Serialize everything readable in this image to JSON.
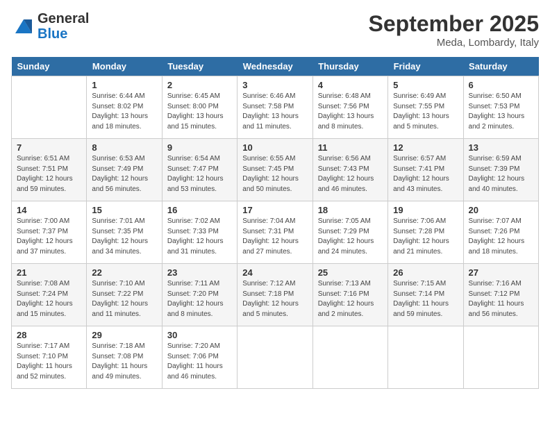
{
  "header": {
    "logo_line1": "General",
    "logo_line2": "Blue",
    "month": "September 2025",
    "location": "Meda, Lombardy, Italy"
  },
  "days_of_week": [
    "Sunday",
    "Monday",
    "Tuesday",
    "Wednesday",
    "Thursday",
    "Friday",
    "Saturday"
  ],
  "weeks": [
    [
      {
        "day": "",
        "sunrise": "",
        "sunset": "",
        "daylight": ""
      },
      {
        "day": "1",
        "sunrise": "Sunrise: 6:44 AM",
        "sunset": "Sunset: 8:02 PM",
        "daylight": "Daylight: 13 hours and 18 minutes."
      },
      {
        "day": "2",
        "sunrise": "Sunrise: 6:45 AM",
        "sunset": "Sunset: 8:00 PM",
        "daylight": "Daylight: 13 hours and 15 minutes."
      },
      {
        "day": "3",
        "sunrise": "Sunrise: 6:46 AM",
        "sunset": "Sunset: 7:58 PM",
        "daylight": "Daylight: 13 hours and 11 minutes."
      },
      {
        "day": "4",
        "sunrise": "Sunrise: 6:48 AM",
        "sunset": "Sunset: 7:56 PM",
        "daylight": "Daylight: 13 hours and 8 minutes."
      },
      {
        "day": "5",
        "sunrise": "Sunrise: 6:49 AM",
        "sunset": "Sunset: 7:55 PM",
        "daylight": "Daylight: 13 hours and 5 minutes."
      },
      {
        "day": "6",
        "sunrise": "Sunrise: 6:50 AM",
        "sunset": "Sunset: 7:53 PM",
        "daylight": "Daylight: 13 hours and 2 minutes."
      }
    ],
    [
      {
        "day": "7",
        "sunrise": "Sunrise: 6:51 AM",
        "sunset": "Sunset: 7:51 PM",
        "daylight": "Daylight: 12 hours and 59 minutes."
      },
      {
        "day": "8",
        "sunrise": "Sunrise: 6:53 AM",
        "sunset": "Sunset: 7:49 PM",
        "daylight": "Daylight: 12 hours and 56 minutes."
      },
      {
        "day": "9",
        "sunrise": "Sunrise: 6:54 AM",
        "sunset": "Sunset: 7:47 PM",
        "daylight": "Daylight: 12 hours and 53 minutes."
      },
      {
        "day": "10",
        "sunrise": "Sunrise: 6:55 AM",
        "sunset": "Sunset: 7:45 PM",
        "daylight": "Daylight: 12 hours and 50 minutes."
      },
      {
        "day": "11",
        "sunrise": "Sunrise: 6:56 AM",
        "sunset": "Sunset: 7:43 PM",
        "daylight": "Daylight: 12 hours and 46 minutes."
      },
      {
        "day": "12",
        "sunrise": "Sunrise: 6:57 AM",
        "sunset": "Sunset: 7:41 PM",
        "daylight": "Daylight: 12 hours and 43 minutes."
      },
      {
        "day": "13",
        "sunrise": "Sunrise: 6:59 AM",
        "sunset": "Sunset: 7:39 PM",
        "daylight": "Daylight: 12 hours and 40 minutes."
      }
    ],
    [
      {
        "day": "14",
        "sunrise": "Sunrise: 7:00 AM",
        "sunset": "Sunset: 7:37 PM",
        "daylight": "Daylight: 12 hours and 37 minutes."
      },
      {
        "day": "15",
        "sunrise": "Sunrise: 7:01 AM",
        "sunset": "Sunset: 7:35 PM",
        "daylight": "Daylight: 12 hours and 34 minutes."
      },
      {
        "day": "16",
        "sunrise": "Sunrise: 7:02 AM",
        "sunset": "Sunset: 7:33 PM",
        "daylight": "Daylight: 12 hours and 31 minutes."
      },
      {
        "day": "17",
        "sunrise": "Sunrise: 7:04 AM",
        "sunset": "Sunset: 7:31 PM",
        "daylight": "Daylight: 12 hours and 27 minutes."
      },
      {
        "day": "18",
        "sunrise": "Sunrise: 7:05 AM",
        "sunset": "Sunset: 7:29 PM",
        "daylight": "Daylight: 12 hours and 24 minutes."
      },
      {
        "day": "19",
        "sunrise": "Sunrise: 7:06 AM",
        "sunset": "Sunset: 7:28 PM",
        "daylight": "Daylight: 12 hours and 21 minutes."
      },
      {
        "day": "20",
        "sunrise": "Sunrise: 7:07 AM",
        "sunset": "Sunset: 7:26 PM",
        "daylight": "Daylight: 12 hours and 18 minutes."
      }
    ],
    [
      {
        "day": "21",
        "sunrise": "Sunrise: 7:08 AM",
        "sunset": "Sunset: 7:24 PM",
        "daylight": "Daylight: 12 hours and 15 minutes."
      },
      {
        "day": "22",
        "sunrise": "Sunrise: 7:10 AM",
        "sunset": "Sunset: 7:22 PM",
        "daylight": "Daylight: 12 hours and 11 minutes."
      },
      {
        "day": "23",
        "sunrise": "Sunrise: 7:11 AM",
        "sunset": "Sunset: 7:20 PM",
        "daylight": "Daylight: 12 hours and 8 minutes."
      },
      {
        "day": "24",
        "sunrise": "Sunrise: 7:12 AM",
        "sunset": "Sunset: 7:18 PM",
        "daylight": "Daylight: 12 hours and 5 minutes."
      },
      {
        "day": "25",
        "sunrise": "Sunrise: 7:13 AM",
        "sunset": "Sunset: 7:16 PM",
        "daylight": "Daylight: 12 hours and 2 minutes."
      },
      {
        "day": "26",
        "sunrise": "Sunrise: 7:15 AM",
        "sunset": "Sunset: 7:14 PM",
        "daylight": "Daylight: 11 hours and 59 minutes."
      },
      {
        "day": "27",
        "sunrise": "Sunrise: 7:16 AM",
        "sunset": "Sunset: 7:12 PM",
        "daylight": "Daylight: 11 hours and 56 minutes."
      }
    ],
    [
      {
        "day": "28",
        "sunrise": "Sunrise: 7:17 AM",
        "sunset": "Sunset: 7:10 PM",
        "daylight": "Daylight: 11 hours and 52 minutes."
      },
      {
        "day": "29",
        "sunrise": "Sunrise: 7:18 AM",
        "sunset": "Sunset: 7:08 PM",
        "daylight": "Daylight: 11 hours and 49 minutes."
      },
      {
        "day": "30",
        "sunrise": "Sunrise: 7:20 AM",
        "sunset": "Sunset: 7:06 PM",
        "daylight": "Daylight: 11 hours and 46 minutes."
      },
      {
        "day": "",
        "sunrise": "",
        "sunset": "",
        "daylight": ""
      },
      {
        "day": "",
        "sunrise": "",
        "sunset": "",
        "daylight": ""
      },
      {
        "day": "",
        "sunrise": "",
        "sunset": "",
        "daylight": ""
      },
      {
        "day": "",
        "sunrise": "",
        "sunset": "",
        "daylight": ""
      }
    ]
  ]
}
